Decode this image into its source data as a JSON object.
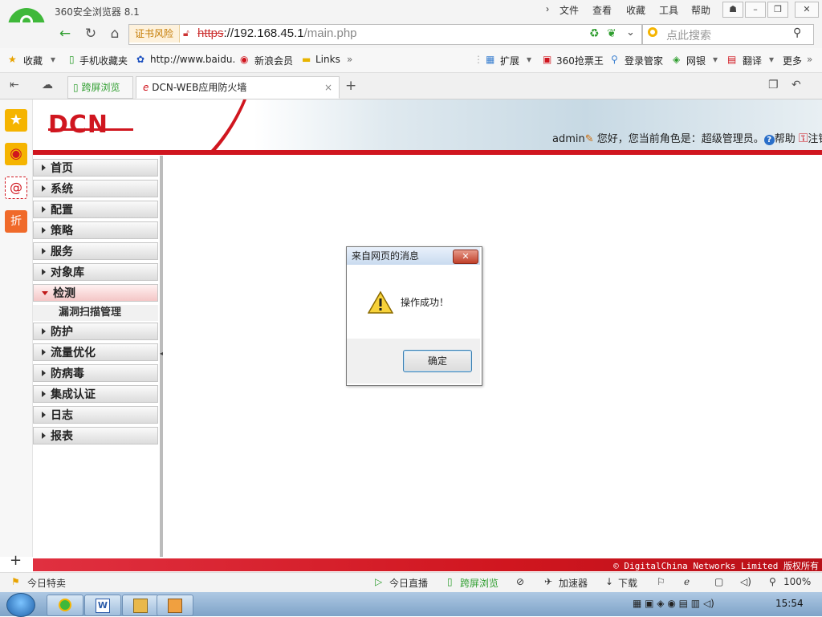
{
  "browser": {
    "app_title": "360安全浏览器 8.1",
    "menu": [
      "文件",
      "查看",
      "收藏",
      "工具",
      "帮助"
    ],
    "cert_warning": "证书风险",
    "url_scheme": "https",
    "url_rest": "://192.168.45.1",
    "url_path": "/main.php",
    "search_placeholder": "点此搜索",
    "bookmarks": [
      "收藏",
      "手机收藏夹",
      "http://www.baidu.",
      "新浪会员",
      "Links"
    ],
    "toolbar_right": [
      "扩展",
      "360抢票王",
      "登录管家",
      "网银",
      "翻译",
      "更多"
    ],
    "tabs": [
      {
        "label": "跨屏浏览"
      },
      {
        "label": "DCN-WEB应用防火墙"
      }
    ]
  },
  "page": {
    "logo": "DCN",
    "user": "admin",
    "greeting": "您好，您当前角色是：超级管理员。",
    "help": "帮助",
    "logout": "注销",
    "menu": [
      {
        "label": "首页"
      },
      {
        "label": "系统"
      },
      {
        "label": "配置"
      },
      {
        "label": "策略"
      },
      {
        "label": "服务"
      },
      {
        "label": "对象库"
      },
      {
        "label": "检测",
        "open": true
      },
      {
        "label": "防护"
      },
      {
        "label": "流量优化"
      },
      {
        "label": "防病毒"
      },
      {
        "label": "集成认证"
      },
      {
        "label": "日志"
      },
      {
        "label": "报表"
      }
    ],
    "submenu_label": "漏洞扫描管理",
    "footer": "© DigitalChina Networks Limited 版权所有"
  },
  "dialog": {
    "title": "来自网页的消息",
    "message": "操作成功！",
    "ok": "确定"
  },
  "statusbar": {
    "left": "今日特卖",
    "live": "今日直播",
    "crossscreen": "跨屏浏览",
    "accelerator": "加速器",
    "download": "下载",
    "zoom": "100%"
  },
  "taskbar": {
    "clock": "15:54"
  },
  "colors": {
    "accent_red": "#d0161f",
    "brand_green": "#3fb83a"
  }
}
